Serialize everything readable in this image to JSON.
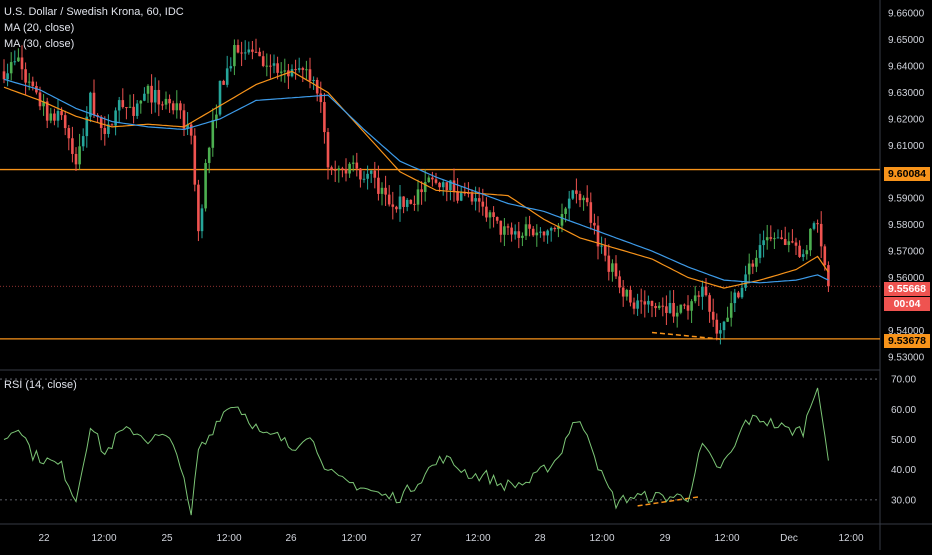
{
  "legend": {
    "symbol": "U.S. Dollar / Swedish Krona, 60, IDC",
    "ma20": "MA (20, close)",
    "ma30": "MA (30, close)",
    "rsi": "RSI (14, close)"
  },
  "colors": {
    "up": "#26a69a",
    "up_bright": "#4caf50",
    "down": "#ef5350",
    "ma20": "#f7931a",
    "ma30": "#3d9be9",
    "rsi": "#7cc576",
    "hline": "#f7931a",
    "current": "#ef5350",
    "grid": "#2a2e39"
  },
  "tags": {
    "upper": "9.60084",
    "current": "9.55668",
    "countdown": "00:04",
    "lower": "9.53678"
  },
  "chart_data": [
    {
      "type": "candlestick",
      "title": "U.S. Dollar / Swedish Krona, 60, IDC",
      "ylim": [
        9.525,
        9.665
      ],
      "y_ticks": [
        9.53,
        9.54,
        9.55,
        9.56,
        9.57,
        9.58,
        9.59,
        9.6,
        9.61,
        9.62,
        9.63,
        9.64,
        9.65,
        9.66
      ],
      "y_tick_labels": [
        "9.53000",
        "9.54000",
        "",
        "9.56000",
        "9.57000",
        "9.58000",
        "9.59000",
        "",
        "9.61000",
        "9.62000",
        "9.63000",
        "9.64000",
        "9.65000",
        "9.66000"
      ],
      "x_labels": [
        "22",
        "12:00",
        "25",
        "12:00",
        "26",
        "12:00",
        "27",
        "12:00",
        "28",
        "12:00",
        "29",
        "12:00",
        "Dec",
        "12:00"
      ],
      "horizontal_lines": [
        9.60084,
        9.53678
      ],
      "current_price": 9.55668,
      "series": [
        {
          "name": "MA (20, close)",
          "anchors": [
            [
              0,
              9.632
            ],
            [
              10,
              9.627
            ],
            [
              20,
              9.621
            ],
            [
              30,
              9.617
            ],
            [
              40,
              9.618
            ],
            [
              50,
              9.617
            ],
            [
              60,
              9.625
            ],
            [
              70,
              9.633
            ],
            [
              80,
              9.638
            ],
            [
              90,
              9.63
            ],
            [
              100,
              9.615
            ],
            [
              110,
              9.6
            ],
            [
              120,
              9.593
            ],
            [
              130,
              9.592
            ],
            [
              140,
              9.591
            ],
            [
              150,
              9.582
            ],
            [
              160,
              9.575
            ],
            [
              170,
              9.571
            ],
            [
              180,
              9.567
            ],
            [
              190,
              9.56
            ],
            [
              200,
              9.556
            ],
            [
              210,
              9.559
            ],
            [
              220,
              9.563
            ],
            [
              226,
              9.568
            ],
            [
              229,
              9.562
            ]
          ]
        },
        {
          "name": "MA (30, close)",
          "anchors": [
            [
              0,
              9.635
            ],
            [
              10,
              9.631
            ],
            [
              20,
              9.624
            ],
            [
              30,
              9.619
            ],
            [
              40,
              9.617
            ],
            [
              50,
              9.616
            ],
            [
              60,
              9.62
            ],
            [
              70,
              9.627
            ],
            [
              80,
              9.628
            ],
            [
              90,
              9.629
            ],
            [
              100,
              9.616
            ],
            [
              110,
              9.604
            ],
            [
              120,
              9.598
            ],
            [
              130,
              9.593
            ],
            [
              140,
              9.588
            ],
            [
              150,
              9.585
            ],
            [
              160,
              9.58
            ],
            [
              170,
              9.575
            ],
            [
              180,
              9.57
            ],
            [
              190,
              9.564
            ],
            [
              200,
              9.559
            ],
            [
              210,
              9.558
            ],
            [
              220,
              9.559
            ],
            [
              226,
              9.561
            ],
            [
              229,
              9.559
            ]
          ]
        }
      ],
      "price_anchors": [
        [
          0,
          9.638
        ],
        [
          4,
          9.642
        ],
        [
          8,
          9.63
        ],
        [
          12,
          9.622
        ],
        [
          16,
          9.622
        ],
        [
          20,
          9.602
        ],
        [
          24,
          9.628
        ],
        [
          28,
          9.612
        ],
        [
          32,
          9.626
        ],
        [
          36,
          9.623
        ],
        [
          40,
          9.63
        ],
        [
          44,
          9.626
        ],
        [
          48,
          9.623
        ],
        [
          52,
          9.614
        ],
        [
          54,
          9.576
        ],
        [
          56,
          9.602
        ],
        [
          60,
          9.632
        ],
        [
          64,
          9.645
        ],
        [
          68,
          9.648
        ],
        [
          72,
          9.643
        ],
        [
          76,
          9.638
        ],
        [
          80,
          9.636
        ],
        [
          84,
          9.637
        ],
        [
          88,
          9.628
        ],
        [
          90,
          9.604
        ],
        [
          94,
          9.603
        ],
        [
          98,
          9.6
        ],
        [
          102,
          9.598
        ],
        [
          106,
          9.59
        ],
        [
          110,
          9.588
        ],
        [
          114,
          9.59
        ],
        [
          118,
          9.596
        ],
        [
          122,
          9.597
        ],
        [
          126,
          9.592
        ],
        [
          130,
          9.589
        ],
        [
          134,
          9.584
        ],
        [
          138,
          9.578
        ],
        [
          142,
          9.576
        ],
        [
          146,
          9.578
        ],
        [
          150,
          9.578
        ],
        [
          154,
          9.58
        ],
        [
          158,
          9.59
        ],
        [
          162,
          9.588
        ],
        [
          166,
          9.57
        ],
        [
          170,
          9.56
        ],
        [
          174,
          9.551
        ],
        [
          178,
          9.55
        ],
        [
          182,
          9.551
        ],
        [
          186,
          9.548
        ],
        [
          190,
          9.548
        ],
        [
          194,
          9.557
        ],
        [
          198,
          9.541
        ],
        [
          202,
          9.549
        ],
        [
          206,
          9.562
        ],
        [
          210,
          9.57
        ],
        [
          214,
          9.575
        ],
        [
          218,
          9.571
        ],
        [
          222,
          9.57
        ],
        [
          226,
          9.583
        ],
        [
          229,
          9.555
        ]
      ]
    },
    {
      "type": "line",
      "title": "RSI (14, close)",
      "ylim": [
        22,
        73
      ],
      "y_ticks": [
        30,
        40,
        50,
        60,
        70
      ],
      "y_tick_labels": [
        "30.00",
        "40.00",
        "50.00",
        "60.00",
        "70.00"
      ],
      "bands": [
        30,
        70
      ],
      "series": [
        {
          "name": "RSI (14, close)",
          "anchors": [
            [
              0,
              50
            ],
            [
              4,
              55
            ],
            [
              8,
              45
            ],
            [
              12,
              43
            ],
            [
              16,
              41
            ],
            [
              20,
              30
            ],
            [
              24,
              55
            ],
            [
              28,
              45
            ],
            [
              32,
              52
            ],
            [
              36,
              53
            ],
            [
              40,
              50
            ],
            [
              44,
              51
            ],
            [
              48,
              47
            ],
            [
              52,
              24
            ],
            [
              54,
              47
            ],
            [
              56,
              49
            ],
            [
              60,
              58
            ],
            [
              64,
              62
            ],
            [
              68,
              57
            ],
            [
              72,
              51
            ],
            [
              76,
              51
            ],
            [
              80,
              47
            ],
            [
              84,
              52
            ],
            [
              88,
              45
            ],
            [
              90,
              39
            ],
            [
              94,
              36
            ],
            [
              98,
              35
            ],
            [
              102,
              33
            ],
            [
              106,
              31
            ],
            [
              110,
              31
            ],
            [
              114,
              35
            ],
            [
              118,
              40
            ],
            [
              122,
              44
            ],
            [
              126,
              41
            ],
            [
              130,
              38
            ],
            [
              134,
              38
            ],
            [
              138,
              35
            ],
            [
              142,
              35
            ],
            [
              146,
              36
            ],
            [
              150,
              40
            ],
            [
              154,
              44
            ],
            [
              158,
              56
            ],
            [
              162,
              53
            ],
            [
              166,
              38
            ],
            [
              170,
              29
            ],
            [
              174,
              31
            ],
            [
              178,
              31
            ],
            [
              182,
              31
            ],
            [
              186,
              31
            ],
            [
              190,
              31
            ],
            [
              194,
              48
            ],
            [
              198,
              40
            ],
            [
              202,
              45
            ],
            [
              206,
              56
            ],
            [
              210,
              57
            ],
            [
              214,
              55
            ],
            [
              218,
              53
            ],
            [
              222,
              53
            ],
            [
              226,
              69
            ],
            [
              229,
              43
            ]
          ]
        }
      ]
    }
  ]
}
